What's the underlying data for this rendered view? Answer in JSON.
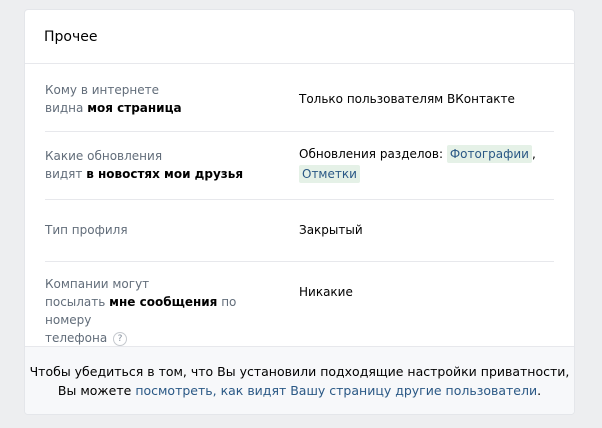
{
  "section": {
    "title": "Прочее"
  },
  "rows": [
    {
      "label_line1": "Кому в интернете",
      "label_line2_plain": "видна ",
      "label_line2_bold": "моя страница",
      "value": "Только пользователям ВКонтакте"
    },
    {
      "label_line1": "Какие обновления",
      "label_line2_plain": "видят ",
      "label_line2_bold": "в новостях мои друзья",
      "value_prefix": "Обновления разделов:",
      "tag1": "Фотографии",
      "comma": ",",
      "tag2": "Отметки"
    },
    {
      "label": "Тип профиля",
      "value": "Закрытый"
    },
    {
      "label_line1": "Компании могут",
      "label_line2_plain": "посылать ",
      "label_line2_bold": "мне сообщения",
      "label_line2_rest": " по номеру",
      "label_line3": "телефона",
      "help_icon": "question-icon",
      "value": "Никакие"
    }
  ],
  "footer": {
    "line1": "Чтобы убедиться в том, что Вы установили подходящие настройки приватности,",
    "line2_prefix": "Вы можете ",
    "link": "посмотреть, как видят Вашу страницу другие пользователи",
    "line2_suffix": "."
  },
  "colors": {
    "background": "#edeef0",
    "link": "#2a5885",
    "label": "#626d7a",
    "tag_bg": "#e5f1e7"
  }
}
